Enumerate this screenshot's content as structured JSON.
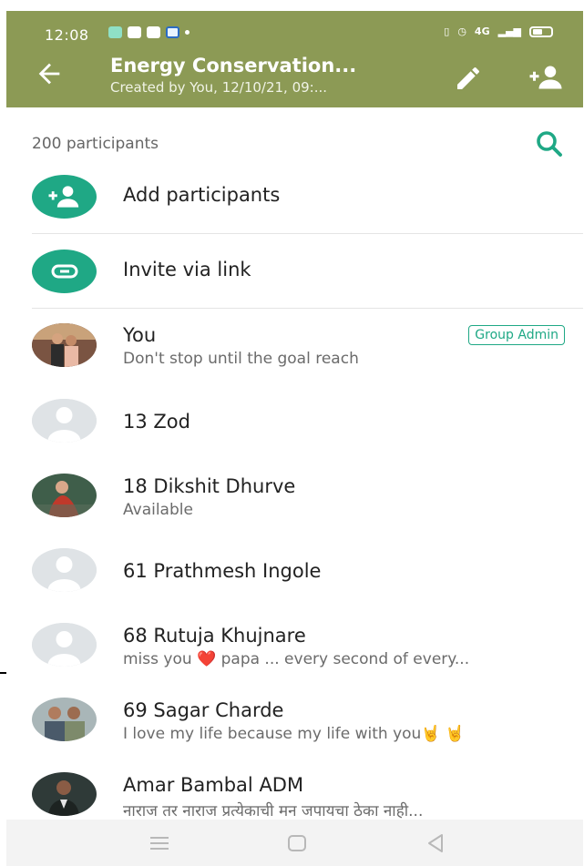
{
  "status_bar": {
    "time": "12:08",
    "network": "4G"
  },
  "header": {
    "title": "Energy Conservation...",
    "subtitle": "Created by You, 12/10/21, 09:..."
  },
  "participants_label": "200 participants",
  "actions": [
    {
      "label": "Add participants",
      "icon": "add-user-icon"
    },
    {
      "label": "Invite via link",
      "icon": "link-icon"
    }
  ],
  "members": [
    {
      "name": "You",
      "status": "Don't stop until the goal reach",
      "badge": "Group Admin",
      "avatar": "photo"
    },
    {
      "name": "13 Zod",
      "status": "",
      "avatar": "default"
    },
    {
      "name": "18 Dikshit Dhurve",
      "status": "Available",
      "avatar": "photo"
    },
    {
      "name": "61 Prathmesh Ingole",
      "status": "",
      "avatar": "default"
    },
    {
      "name": "68 Rutuja Khujnare",
      "status": "miss you ❤️ papa ... every second of every...",
      "avatar": "default"
    },
    {
      "name": "69 Sagar Charde",
      "status": "I love my life because my life with you🤘 🤘",
      "avatar": "photo"
    },
    {
      "name": "Amar Bambal ADM",
      "status": "नाराज तर नाराज  प्रत्येकाची मन जपायचा ठेका  नाही...",
      "avatar": "photo"
    }
  ],
  "colors": {
    "header": "#8c9a55",
    "accent": "#1fa885"
  }
}
